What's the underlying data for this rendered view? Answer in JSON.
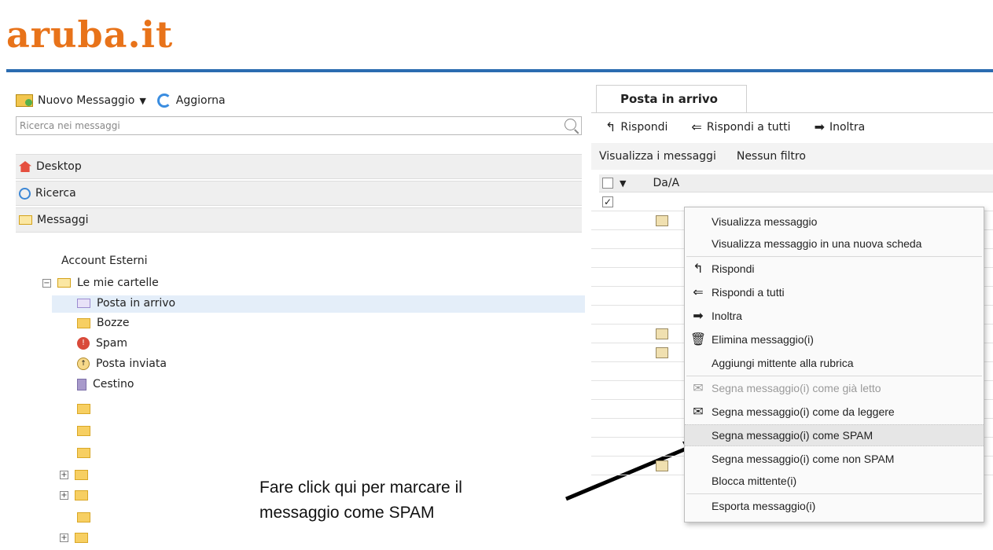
{
  "brand": {
    "logo_text": "aruba.it"
  },
  "left": {
    "toolbar": {
      "new_message": "Nuovo Messaggio",
      "refresh": "Aggiorna"
    },
    "search": {
      "placeholder": "Ricerca nei messaggi"
    },
    "nav": [
      {
        "label": "Desktop",
        "icon": "home-icon"
      },
      {
        "label": "Ricerca",
        "icon": "search-icon"
      },
      {
        "label": "Messaggi",
        "icon": "mail-icon"
      }
    ],
    "tree": {
      "external_accounts": "Account Esterni",
      "root": "Le mie cartelle",
      "folders": [
        "Posta in arrivo",
        "Bozze",
        "Spam",
        "Posta inviata",
        "Cestino"
      ],
      "selected": "Posta in arrivo"
    }
  },
  "right": {
    "tab": "Posta in arrivo",
    "toolbar": {
      "reply": "Rispondi",
      "reply_all": "Rispondi a tutti",
      "forward": "Inoltra"
    },
    "filter": {
      "view_label": "Visualizza i messaggi",
      "filter_value": "Nessun filtro"
    },
    "columns": {
      "from_to": "Da/A"
    }
  },
  "context_menu": {
    "items": [
      {
        "label": "Visualizza messaggio",
        "icon": "",
        "state": "normal"
      },
      {
        "label": "Visualizza messaggio in una nuova scheda",
        "icon": "",
        "state": "normal"
      },
      {
        "label": "Rispondi",
        "icon": "reply-icon",
        "state": "normal"
      },
      {
        "label": "Rispondi a tutti",
        "icon": "reply-all-icon",
        "state": "normal"
      },
      {
        "label": "Inoltra",
        "icon": "forward-icon",
        "state": "normal"
      },
      {
        "label": "Elimina messaggio(i)",
        "icon": "trash-icon",
        "state": "normal"
      },
      {
        "label": "Aggiungi mittente alla rubrica",
        "icon": "",
        "state": "normal"
      },
      {
        "label": "Segna messaggio(i) come già letto",
        "icon": "envelope-open-icon",
        "state": "disabled"
      },
      {
        "label": "Segna messaggio(i) come da leggere",
        "icon": "envelope-icon",
        "state": "normal"
      },
      {
        "label": "Segna messaggio(i) come SPAM",
        "icon": "",
        "state": "hover"
      },
      {
        "label": "Segna messaggio(i) come non SPAM",
        "icon": "",
        "state": "normal"
      },
      {
        "label": "Blocca mittente(i)",
        "icon": "",
        "state": "normal"
      },
      {
        "label": "Esporta messaggio(i)",
        "icon": "",
        "state": "normal"
      }
    ]
  },
  "annotation": {
    "line1": "Fare click qui per marcare il",
    "line2": "messaggio come SPAM"
  },
  "colors": {
    "brand_orange": "#e8731a",
    "rule_blue": "#2b6cb0",
    "selection": "#e4eef9"
  }
}
